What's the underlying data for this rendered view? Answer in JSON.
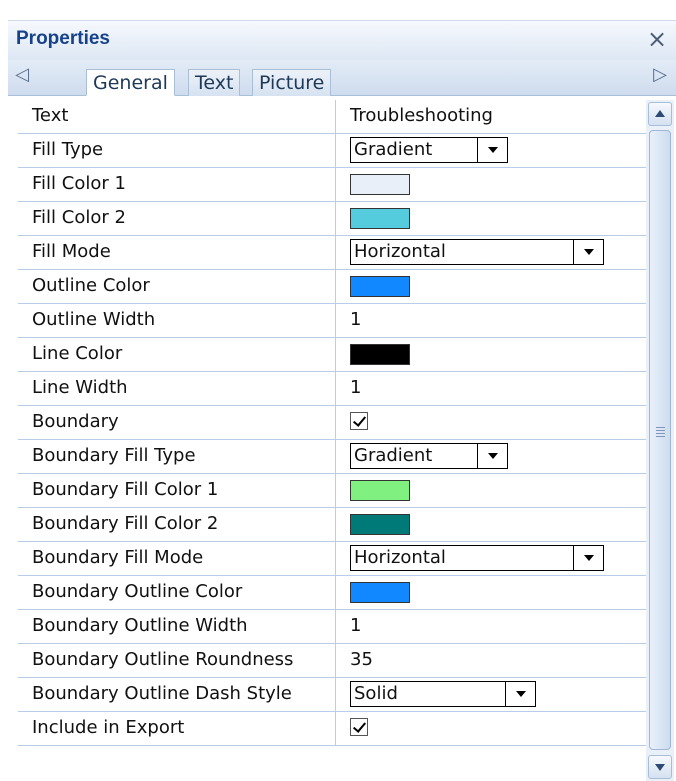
{
  "panel": {
    "title": "Properties",
    "close_icon": "close-icon"
  },
  "tabs": [
    {
      "label": "General",
      "active": true
    },
    {
      "label": "Text",
      "active": false
    },
    {
      "label": "Picture",
      "active": false
    }
  ],
  "tab_scroll": {
    "left_icon": "scroll-left-icon",
    "right_icon": "scroll-right-icon"
  },
  "properties": [
    {
      "name": "Text",
      "type": "text",
      "value": "Troubleshooting"
    },
    {
      "name": "Fill Type",
      "type": "dropdown",
      "value": "Gradient"
    },
    {
      "name": "Fill Color 1",
      "type": "color",
      "color": "#e8eff8"
    },
    {
      "name": "Fill Color 2",
      "type": "color",
      "color": "#55ccdd"
    },
    {
      "name": "Fill Mode",
      "type": "dropdown-wide",
      "value": "Horizontal"
    },
    {
      "name": "Outline Color",
      "type": "color",
      "color": "#1188ff"
    },
    {
      "name": "Outline Width",
      "type": "text",
      "value": "1"
    },
    {
      "name": "Line Color",
      "type": "color",
      "color": "#000000"
    },
    {
      "name": "Line Width",
      "type": "text",
      "value": "1"
    },
    {
      "name": "Boundary",
      "type": "checkbox",
      "checked": true
    },
    {
      "name": "Boundary Fill Type",
      "type": "dropdown",
      "value": "Gradient"
    },
    {
      "name": "Boundary Fill Color 1",
      "type": "color",
      "color": "#80f080"
    },
    {
      "name": "Boundary Fill Color 2",
      "type": "color",
      "color": "#007a78"
    },
    {
      "name": "Boundary Fill Mode",
      "type": "dropdown-wide",
      "value": "Horizontal"
    },
    {
      "name": "Boundary Outline Color",
      "type": "color",
      "color": "#1188ff"
    },
    {
      "name": "Boundary Outline Width",
      "type": "text",
      "value": "1"
    },
    {
      "name": "Boundary Outline Roundness",
      "type": "text",
      "value": "35"
    },
    {
      "name": "Boundary Outline Dash Style",
      "type": "dropdown-mid",
      "value": "Solid"
    },
    {
      "name": "Include in Export",
      "type": "checkbox",
      "checked": true
    }
  ]
}
